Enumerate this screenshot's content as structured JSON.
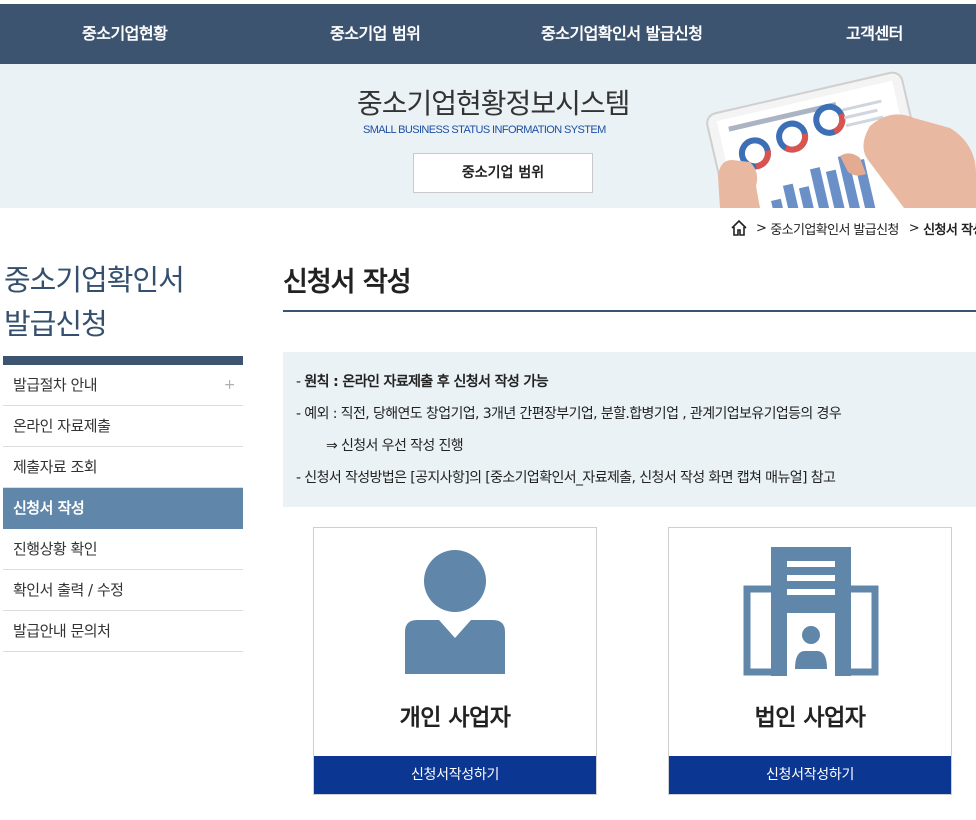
{
  "nav": {
    "items": [
      {
        "label": "중소기업현황"
      },
      {
        "label": "중소기업 범위"
      },
      {
        "label": "중소기업확인서 발급신청"
      },
      {
        "label": "고객센터"
      }
    ]
  },
  "banner": {
    "title": "중소기업현황정보시스템",
    "subtitle": "SMALL BUSINESS STATUS INFORMATION SYSTEM",
    "button_label": "중소기업 범위"
  },
  "breadcrumb": {
    "home_icon": "home-icon",
    "items": [
      "중소기업확인서 발급신청",
      "신청서 작성"
    ],
    "separator": ">"
  },
  "sidebar": {
    "title_line1": "중소기업확인서",
    "title_line2": "발급신청",
    "expand_symbol": "+",
    "items": [
      {
        "label": "발급절차 안내"
      },
      {
        "label": "온라인 자료제출"
      },
      {
        "label": "제출자료 조회"
      },
      {
        "label": "신청서 작성"
      },
      {
        "label": "진행상황 확인"
      },
      {
        "label": "확인서 출력 / 수정"
      },
      {
        "label": "발급안내 문의처"
      }
    ]
  },
  "main": {
    "title": "신청서 작성",
    "notice": {
      "line1_prefix": "- ",
      "line1_bold": "원칙 : 온라인 자료제출 후 신청서 작성 가능",
      "line2": "- 예외 : 직전, 당해연도 창업기업, 3개년 간편장부기업, 분할.합병기업 , 관계기업보유기업등의 경우",
      "line3": "⇒ 신청서 우선 작성 진행",
      "line4": "- 신청서 작성방법은 [공지사항]의 [중소기업확인서_자료제출, 신청서 작성 화면 캡쳐 매뉴얼] 참고"
    },
    "cards": [
      {
        "label": "개인 사업자",
        "button": "신청서작성하기",
        "icon": "person-icon"
      },
      {
        "label": "법인 사업자",
        "button": "신청서작성하기",
        "icon": "building-icon"
      }
    ]
  },
  "colors": {
    "nav_bg": "#3d5471",
    "banner_bg": "#eaf2f6",
    "sidebar_active": "#6086a9",
    "card_button": "#0b3692",
    "icon_blue": "#6086a9"
  }
}
